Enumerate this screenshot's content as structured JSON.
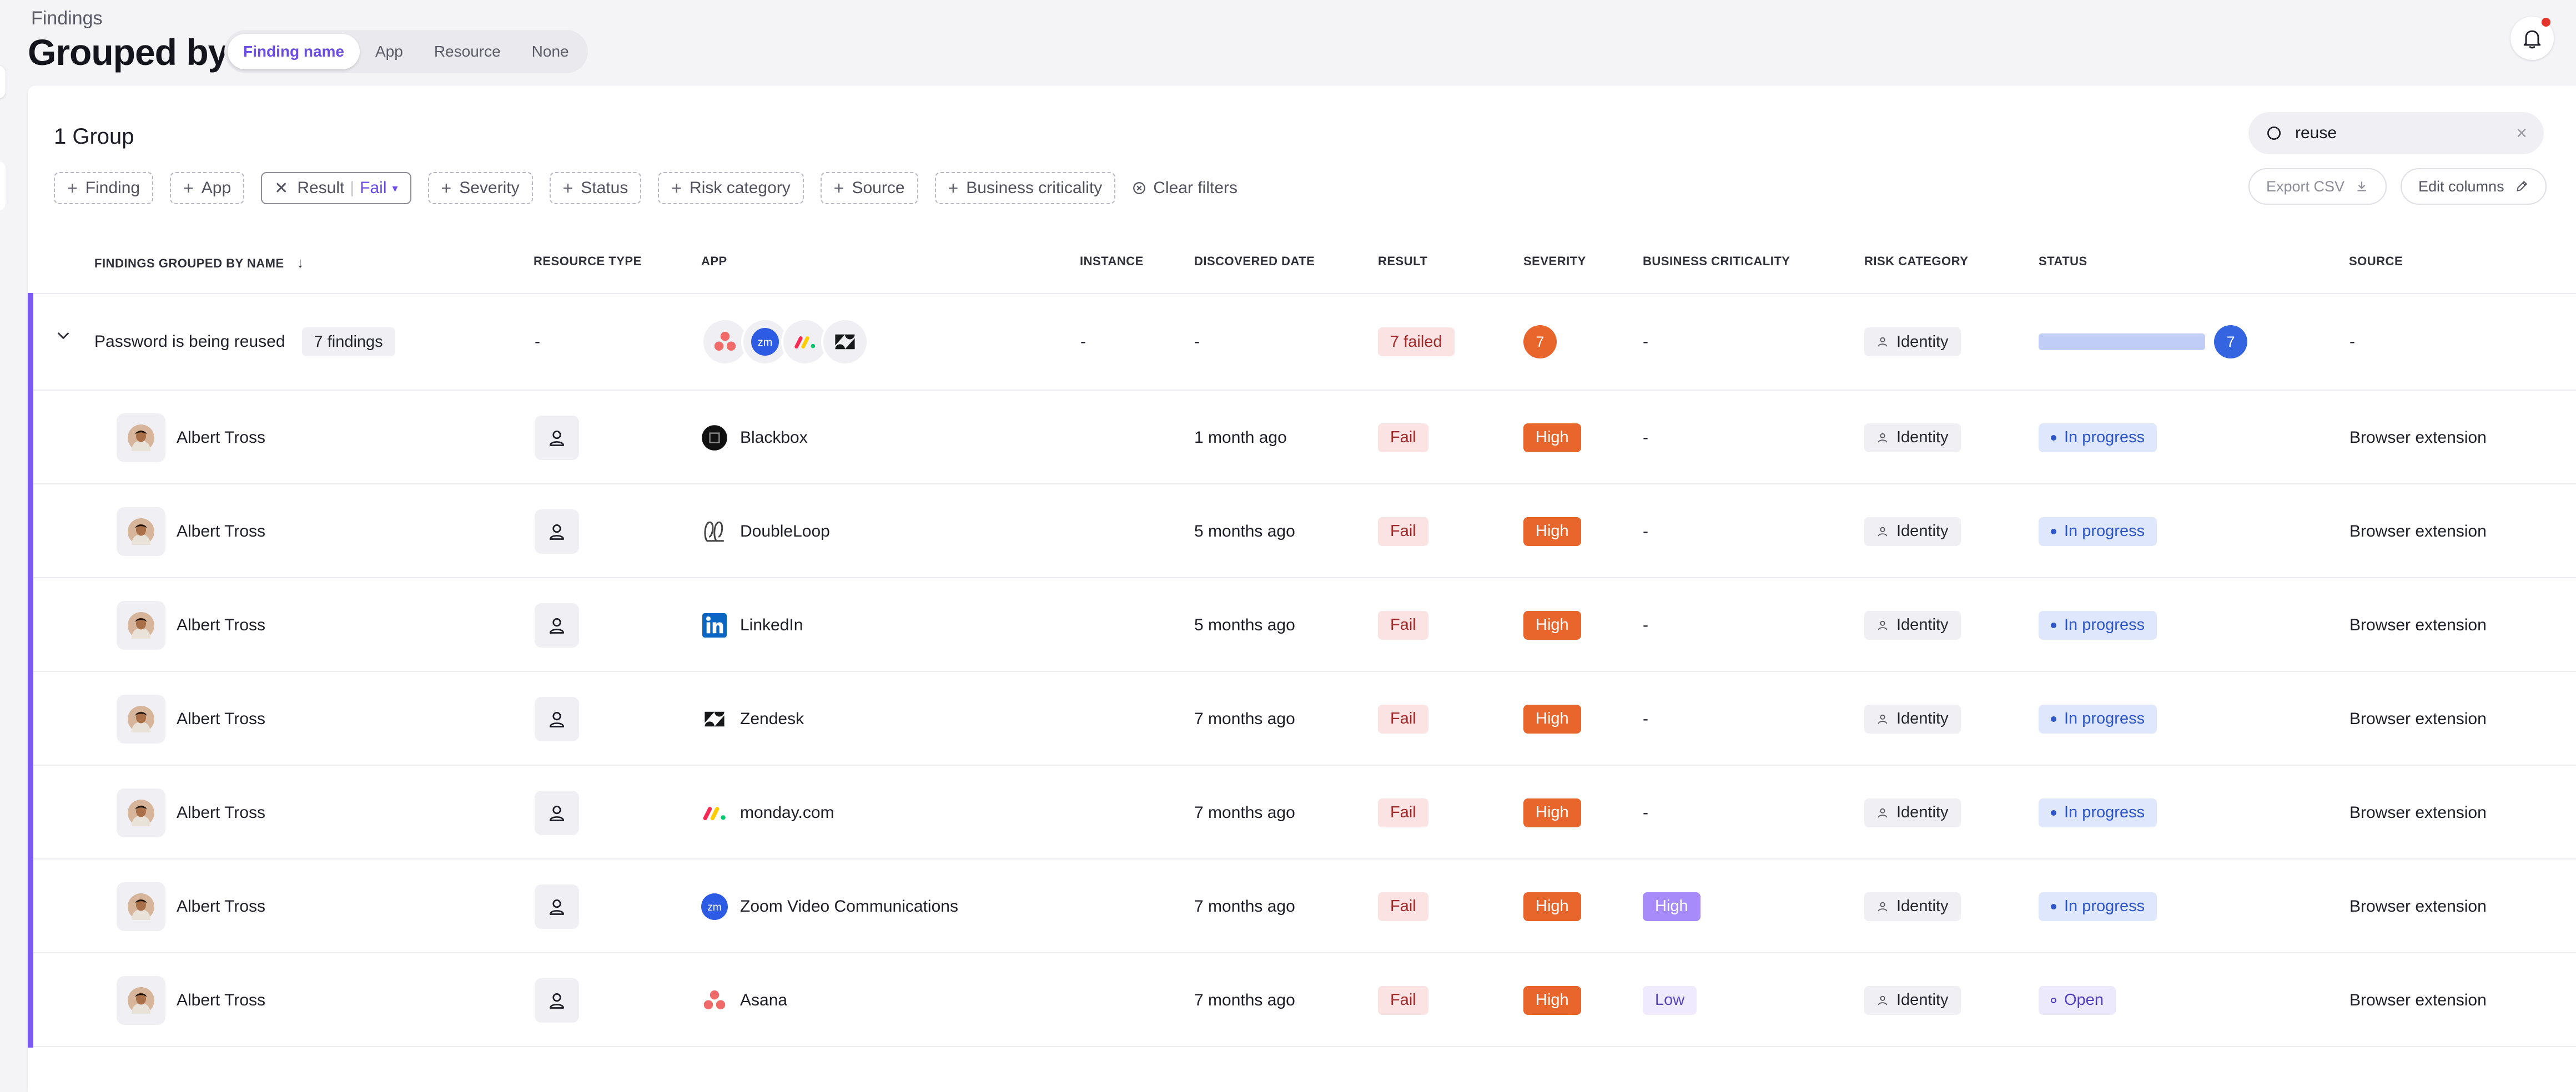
{
  "header": {
    "breadcrumb": "Findings",
    "title": "Grouped by",
    "group_tabs": [
      {
        "label": "Finding name",
        "active": true
      },
      {
        "label": "App",
        "active": false
      },
      {
        "label": "Resource",
        "active": false
      },
      {
        "label": "None",
        "active": false
      }
    ]
  },
  "toolbar": {
    "group_count": "1 Group",
    "search_value": "reuse",
    "export_label": "Export CSV",
    "edit_columns_label": "Edit columns",
    "clear_filters_label": "Clear filters",
    "filters": {
      "finding": "Finding",
      "app": "App",
      "result_key": "Result",
      "result_value": "Fail",
      "severity": "Severity",
      "status": "Status",
      "risk_category": "Risk category",
      "source": "Source",
      "business_criticality": "Business criticality"
    }
  },
  "table": {
    "columns": {
      "name": "FINDINGS GROUPED BY NAME",
      "resource_type": "RESOURCE TYPE",
      "app": "APP",
      "instance": "INSTANCE",
      "discovered": "DISCOVERED DATE",
      "result": "RESULT",
      "severity": "SEVERITY",
      "business": "BUSINESS CRITICALITY",
      "risk": "RISK CATEGORY",
      "status": "STATUS",
      "source": "SOURCE"
    },
    "group": {
      "name": "Password is being reused",
      "count_label": "7 findings",
      "resource_type": "-",
      "instance": "-",
      "discovered": "-",
      "result": "7 failed",
      "severity_count": "7",
      "business": "-",
      "risk": "Identity",
      "status_count": "7",
      "status_fraction": 1.0,
      "source": "-"
    },
    "rows": [
      {
        "user": "Albert Tross",
        "app": "Blackbox",
        "discovered": "1 month ago",
        "result": "Fail",
        "severity": "High",
        "business": "-",
        "risk": "Identity",
        "status": "In progress",
        "source": "Browser extension"
      },
      {
        "user": "Albert Tross",
        "app": "DoubleLoop",
        "discovered": "5 months ago",
        "result": "Fail",
        "severity": "High",
        "business": "-",
        "risk": "Identity",
        "status": "In progress",
        "source": "Browser extension"
      },
      {
        "user": "Albert Tross",
        "app": "LinkedIn",
        "discovered": "5 months ago",
        "result": "Fail",
        "severity": "High",
        "business": "-",
        "risk": "Identity",
        "status": "In progress",
        "source": "Browser extension"
      },
      {
        "user": "Albert Tross",
        "app": "Zendesk",
        "discovered": "7 months ago",
        "result": "Fail",
        "severity": "High",
        "business": "-",
        "risk": "Identity",
        "status": "In progress",
        "source": "Browser extension"
      },
      {
        "user": "Albert Tross",
        "app": "monday.com",
        "discovered": "7 months ago",
        "result": "Fail",
        "severity": "High",
        "business": "-",
        "risk": "Identity",
        "status": "In progress",
        "source": "Browser extension"
      },
      {
        "user": "Albert Tross",
        "app": "Zoom Video Communications",
        "discovered": "7 months ago",
        "result": "Fail",
        "severity": "High",
        "business": "High",
        "risk": "Identity",
        "status": "In progress",
        "source": "Browser extension"
      },
      {
        "user": "Albert Tross",
        "app": "Asana",
        "discovered": "7 months ago",
        "result": "Fail",
        "severity": "High",
        "business": "Low",
        "risk": "Identity",
        "status": "Open",
        "source": "Browser extension"
      }
    ]
  },
  "icons": {
    "app_icons": [
      "blackbox-icon",
      "doubleloop-icon",
      "linkedin-icon",
      "zendesk-icon",
      "monday-icon",
      "zoom-icon",
      "asana-icon"
    ]
  },
  "colors": {
    "accent": "#7a5af0",
    "fail_bg": "#fce3e3",
    "high_severity": "#e8652c",
    "in_progress": "#2f56c9"
  }
}
